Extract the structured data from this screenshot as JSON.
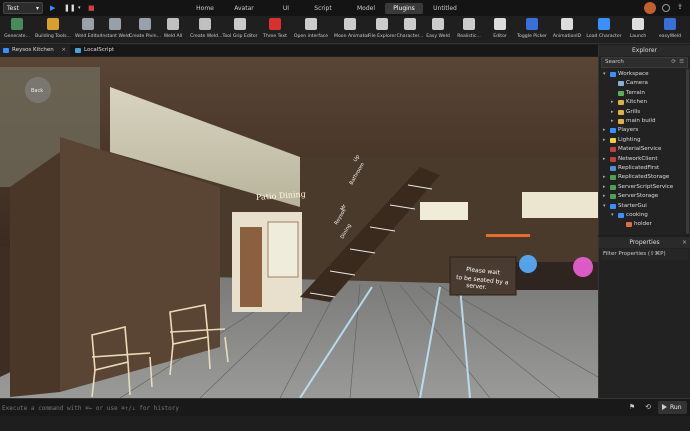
{
  "topbar": {
    "place_name": "Test",
    "menu_tabs": [
      {
        "label": "Home",
        "active": false
      },
      {
        "label": "Avatar",
        "active": false
      },
      {
        "label": "UI",
        "active": false
      },
      {
        "label": "Script",
        "active": false
      },
      {
        "label": "Model",
        "active": false
      },
      {
        "label": "Plugins",
        "active": true
      },
      {
        "label": "Untitled",
        "active": false
      }
    ]
  },
  "ribbon": {
    "items": [
      {
        "label": "Generate...",
        "color": "#4a8a5a",
        "icon": "generate-icon"
      },
      {
        "label": "Building Tools...",
        "color": "#d8a030",
        "icon": "building-tools-icon"
      },
      {
        "label": "Weld Editor",
        "color": "#9aa0a8",
        "icon": "weld-editor-icon"
      },
      {
        "label": "Instant Weld",
        "color": "#9aa0a8",
        "icon": "instant-weld-icon"
      },
      {
        "label": "Create Pivin...",
        "color": "#9aa0a8",
        "icon": "create-pivot-icon"
      },
      {
        "label": "Weld All",
        "color": "#c0c0c0",
        "icon": "weld-all-icon"
      },
      {
        "label": "Create Weld...",
        "color": "#c0c0c0",
        "icon": "create-weld-icon"
      },
      {
        "label": "Tool Grip Editor",
        "color": "#c9c9c9",
        "icon": "tool-grip-icon"
      },
      {
        "label": "Three Text",
        "color": "#d83030",
        "icon": "three-text-icon"
      },
      {
        "label": "Open interface",
        "color": "#cccccc",
        "icon": "open-interface-icon"
      },
      {
        "label": "Moon Animator",
        "color": "#cccccc",
        "icon": "moon-animator-icon"
      },
      {
        "label": "File Explorer",
        "color": "#cccccc",
        "icon": "file-explorer-icon"
      },
      {
        "label": "Character...",
        "color": "#cccccc",
        "icon": "character-icon"
      },
      {
        "label": "Easy Weld",
        "color": "#cccccc",
        "icon": "easy-weld-icon"
      },
      {
        "label": "Realistic...",
        "color": "#cccccc",
        "icon": "realistic-icon"
      },
      {
        "label": "Editor",
        "color": "#dddddd",
        "icon": "cloud-editor-icon"
      },
      {
        "label": "Toggle Picker",
        "color": "#3a6fd8",
        "icon": "toggle-picker-icon"
      },
      {
        "label": "AnimationID",
        "color": "#dddddd",
        "icon": "animation-id-icon"
      },
      {
        "label": "Load Character",
        "color": "#3a8fff",
        "icon": "load-character-icon"
      },
      {
        "label": "Launch",
        "color": "#dddddd",
        "icon": "launch-icon"
      },
      {
        "label": "easyWeld",
        "color": "#3a6fd8",
        "icon": "easy-weld-blue-icon"
      }
    ]
  },
  "doc_tabs": [
    {
      "label": "Reysos Kitchen",
      "closable": true
    },
    {
      "label": "LocalScript",
      "closable": false
    }
  ],
  "viewport": {
    "sign_patio": "Patio Dining",
    "sign_wait_1": "Please wait",
    "sign_wait_2": "to be seated by a",
    "sign_wait_3": "server.",
    "stair_text_1": "Up",
    "stair_text_2": "Bathroom",
    "stair_text_3": "Mr",
    "stair_text_4": "Reysos",
    "stair_text_5": "Dining",
    "back_button": "Back"
  },
  "explorer": {
    "title": "Explorer",
    "search_placeholder": "Search",
    "tree": [
      {
        "label": "Workspace",
        "indent": 0,
        "arrow": "▾",
        "color": "#3a8fff"
      },
      {
        "label": "Camera",
        "indent": 1,
        "arrow": "",
        "color": "#88b0d8"
      },
      {
        "label": "Terrain",
        "indent": 1,
        "arrow": "",
        "color": "#58b058"
      },
      {
        "label": "Kitchen",
        "indent": 1,
        "arrow": "▸",
        "color": "#e0b040"
      },
      {
        "label": "Grills",
        "indent": 1,
        "arrow": "▸",
        "color": "#e0b040"
      },
      {
        "label": "main build",
        "indent": 1,
        "arrow": "▸",
        "color": "#e0b040"
      },
      {
        "label": "Players",
        "indent": 0,
        "arrow": "▸",
        "color": "#3a8fff"
      },
      {
        "label": "Lighting",
        "indent": 0,
        "arrow": "▸",
        "color": "#f0d040"
      },
      {
        "label": "MaterialService",
        "indent": 0,
        "arrow": "",
        "color": "#c04040"
      },
      {
        "label": "NetworkClient",
        "indent": 0,
        "arrow": "▸",
        "color": "#c04040"
      },
      {
        "label": "ReplicatedFirst",
        "indent": 0,
        "arrow": "",
        "color": "#5090d0"
      },
      {
        "label": "ReplicatedStorage",
        "indent": 0,
        "arrow": "▸",
        "color": "#50a050"
      },
      {
        "label": "ServerScriptService",
        "indent": 0,
        "arrow": "▸",
        "color": "#50a050"
      },
      {
        "label": "ServerStorage",
        "indent": 0,
        "arrow": "▸",
        "color": "#50a050"
      },
      {
        "label": "StarterGui",
        "indent": 0,
        "arrow": "▾",
        "color": "#3a8fff"
      },
      {
        "label": "cooking",
        "indent": 1,
        "arrow": "▾",
        "color": "#3a8fff"
      },
      {
        "label": "holder",
        "indent": 2,
        "arrow": "",
        "color": "#e07040"
      }
    ]
  },
  "properties": {
    "title": "Properties",
    "filter_label": "Filter Properties (⇧⌘P)"
  },
  "command_bar": {
    "placeholder": "Execute a command with ⌘← or use ⌘↑/↓ for history",
    "run_label": "Run"
  }
}
